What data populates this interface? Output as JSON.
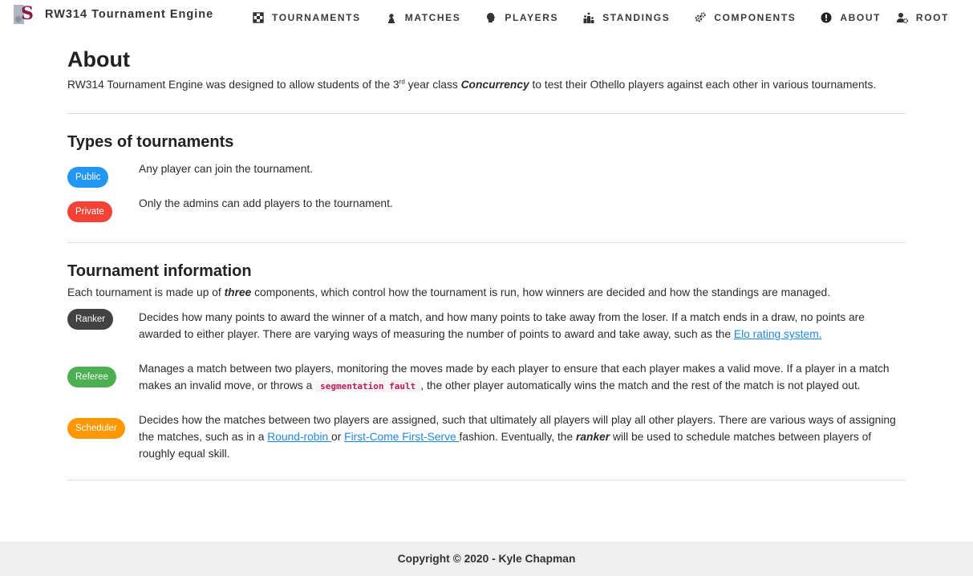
{
  "brand": {
    "title": "RW314 Tournament Engine",
    "logo_icon": "stellenbosch-logo-icon"
  },
  "nav": {
    "items": [
      {
        "label": "TOURNAMENTS",
        "icon": "checkerboard-icon"
      },
      {
        "label": "MATCHES",
        "icon": "chess-knight-icon"
      },
      {
        "label": "PLAYERS",
        "icon": "head-icon"
      },
      {
        "label": "STANDINGS",
        "icon": "podium-icon"
      },
      {
        "label": "COMPONENTS",
        "icon": "gears-icon"
      },
      {
        "label": "ABOUT",
        "icon": "info-icon"
      }
    ],
    "user": {
      "label": "ROOT",
      "icon": "user-gear-icon"
    }
  },
  "about": {
    "title": "About",
    "intro_before": "RW314 Tournament Engine was designed to allow students of the 3",
    "intro_sup": "rd",
    "intro_mid": " year class ",
    "intro_em": "Concurrency",
    "intro_after": " to test their Othello players against each other in various tournaments."
  },
  "types": {
    "title": "Types of tournaments",
    "items": [
      {
        "badge": "Public",
        "color": "#2196f3",
        "desc": "Any player can join the tournament."
      },
      {
        "badge": "Private",
        "color": "#f44336",
        "desc": "Only the admins can add players to the tournament."
      }
    ]
  },
  "info": {
    "title": "Tournament information",
    "line_before": "Each tournament is made up of ",
    "line_em": "three",
    "line_after": " components, which control how the tournament is run, how winners are decided and how the standings are managed.",
    "ranker": {
      "badge": "Ranker",
      "color": "#424242",
      "desc": "Decides how many points to award the winner of a match, and how many points to take away from the loser. If a match ends in a draw, no points are awarded to either player. There are varying ways of measuring the number of points to award and take away, such as the ",
      "link": "Elo rating system."
    },
    "referee": {
      "badge": "Referee",
      "color": "#4caf50",
      "desc_before": "Manages a match between two players, monitoring the moves made by each player to ensure that each player makes a valid move. If a player in a match makes an invalid move, or throws a ",
      "code": "segmentation fault",
      "desc_after": ", the other player automatically wins the match and the rest of the match is not played out."
    },
    "scheduler": {
      "badge": "Scheduler",
      "color": "#ff9800",
      "desc_before": "Decides how the matches between two players are assigned, such that ultimately all players will play all other players. There are various ways of assigning the matches, such as in a ",
      "link1": "Round-robin ",
      "or": " or ",
      "link2": "First-Come First-Serve ",
      "desc_mid": "fashion. Eventually, the ",
      "em": "ranker",
      "desc_after": " will be used to schedule matches between players of roughly equal skill."
    }
  },
  "footer": {
    "text": "Copyright © 2020 - Kyle Chapman"
  }
}
